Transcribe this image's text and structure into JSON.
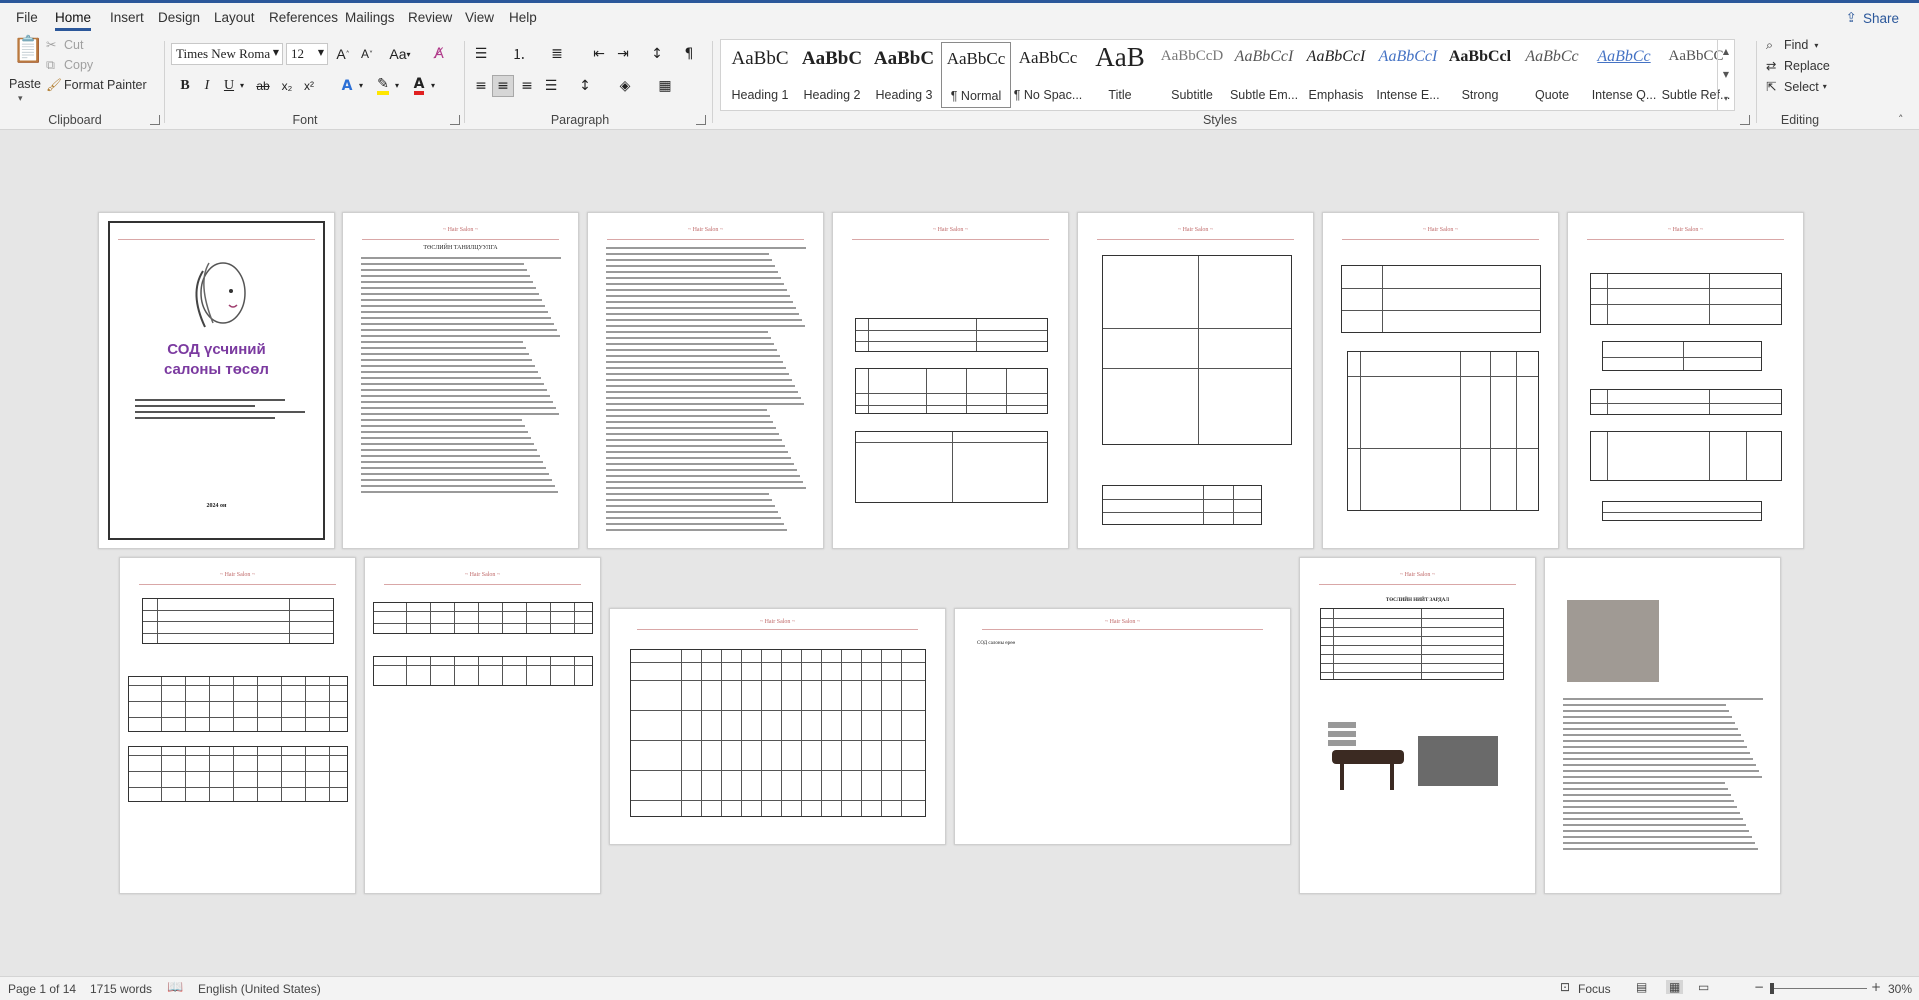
{
  "colors": {
    "accent": "#2b579a",
    "ribbon_bg": "#f3f3f3",
    "doc_bg": "#e6e6e6",
    "cover_title": "#7b3aa0"
  },
  "tabs": [
    "File",
    "Home",
    "Insert",
    "Design",
    "Layout",
    "References",
    "Mailings",
    "Review",
    "View",
    "Help"
  ],
  "active_tab": "Home",
  "share_label": "Share",
  "clipboard": {
    "paste": "Paste",
    "cut": "Cut",
    "copy": "Copy",
    "format_painter": "Format Painter",
    "label": "Clipboard"
  },
  "font": {
    "name": "Times New Roma",
    "size": "12",
    "label": "Font",
    "bold": "B",
    "italic": "I",
    "underline": "U",
    "strike": "ab",
    "subscript": "x₂",
    "superscript": "x²",
    "grow": "A",
    "shrink": "A",
    "case": "Aa"
  },
  "paragraph": {
    "label": "Paragraph"
  },
  "styles": {
    "label": "Styles",
    "items": [
      {
        "sample": "AaBbC",
        "name": "Heading 1"
      },
      {
        "sample": "AaBbC",
        "name": "Heading 2"
      },
      {
        "sample": "AaBbC",
        "name": "Heading 3"
      },
      {
        "sample": "AaBbCc",
        "name": "¶ Normal"
      },
      {
        "sample": "AaBbCc",
        "name": "¶ No Spac..."
      },
      {
        "sample": "AaB",
        "name": "Title"
      },
      {
        "sample": "AaBbCcD",
        "name": "Subtitle"
      },
      {
        "sample": "AaBbCcI",
        "name": "Subtle Em..."
      },
      {
        "sample": "AaBbCcI",
        "name": "Emphasis"
      },
      {
        "sample": "AaBbCcI",
        "name": "Intense E..."
      },
      {
        "sample": "AaBbCcl",
        "name": "Strong"
      },
      {
        "sample": "AaBbCc",
        "name": "Quote"
      },
      {
        "sample": "AaBbCc",
        "name": "Intense Q..."
      },
      {
        "sample": "AaBbCC",
        "name": "Subtle Ref..."
      }
    ],
    "selected": "¶ Normal"
  },
  "editing": {
    "label": "Editing",
    "find": "Find",
    "replace": "Replace",
    "select": "Select"
  },
  "document": {
    "cover_title_1": "СОД үсчиний",
    "cover_title_2": "салоны төсөл",
    "cover_year": "2024 он",
    "page2_heading": "ТӨСЛИЙН ТАНИЛЦУУЛГА",
    "page10_text": "СОД салоны өрөө",
    "page11_heading": "ТӨСЛИЙН НИЙТ ЗАРДАЛ"
  },
  "status": {
    "page": "Page 1 of 14",
    "words": "1715 words",
    "language": "English (United States)",
    "focus": "Focus",
    "zoom": "30%"
  }
}
